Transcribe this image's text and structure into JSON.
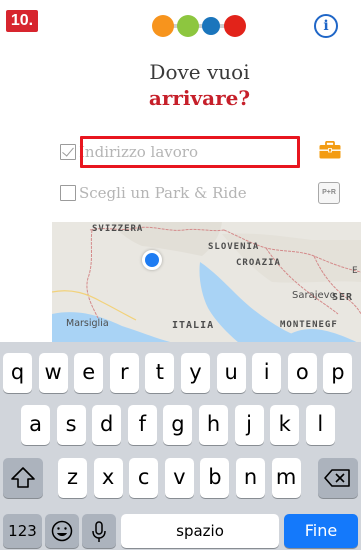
{
  "step_badge": "10.",
  "header": {
    "logo_colors": [
      "#f7941d",
      "#8dc63f",
      "#1b75bc",
      "#e2231a"
    ],
    "info_icon": "i"
  },
  "title": {
    "line1": "Dove vuoi",
    "line2": "arrivare?"
  },
  "form": {
    "work_address": {
      "checked": true,
      "placeholder": "Indirizzo lavoro",
      "action_icon": "briefcase-icon"
    },
    "park_ride": {
      "checked": false,
      "label": "Scegli un Park & Ride",
      "action_label": "P+R"
    }
  },
  "map": {
    "labels": {
      "switzerland": "SVIZZERA",
      "slovenia": "SLOVENIA",
      "croatia": "CROAZIA",
      "sarajevo": "Sarajevo",
      "serbia": "SER",
      "marseille": "Marsiglia",
      "italy": "ITALIA",
      "montenegro": "MONTENEGF",
      "letter_e": "E"
    }
  },
  "keyboard": {
    "row1": [
      "q",
      "w",
      "e",
      "r",
      "t",
      "y",
      "u",
      "i",
      "o",
      "p"
    ],
    "row2": [
      "a",
      "s",
      "d",
      "f",
      "g",
      "h",
      "j",
      "k",
      "l"
    ],
    "row3": [
      "z",
      "x",
      "c",
      "v",
      "b",
      "n",
      "m"
    ],
    "numbers_key": "123",
    "space_key": "spazio",
    "return_key": "Fine"
  },
  "colors": {
    "accent_red": "#c61f2a",
    "highlight_red": "#e8161f",
    "info_blue": "#1f66c7",
    "return_blue": "#1479fb",
    "briefcase_orange": "#f39c12"
  }
}
